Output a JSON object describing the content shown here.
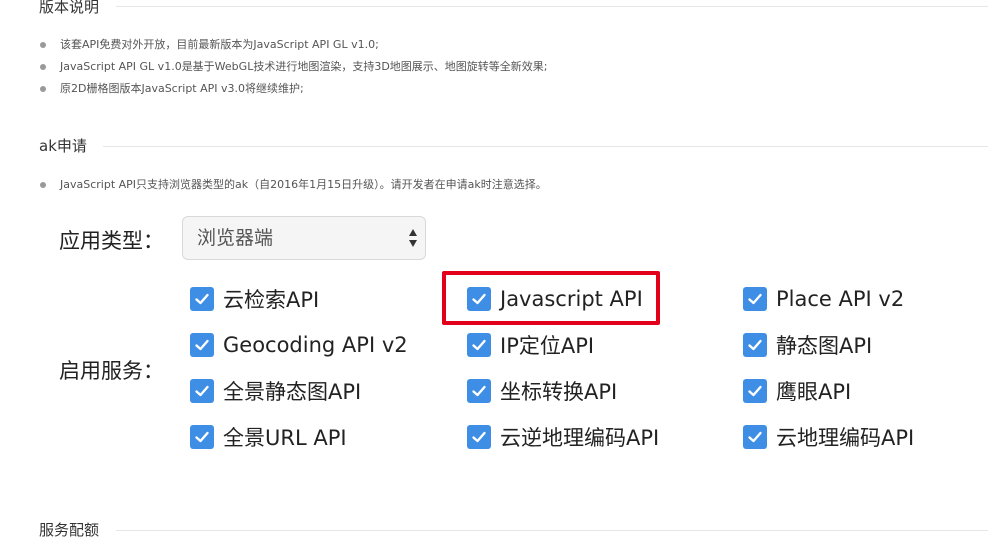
{
  "sections": {
    "version": {
      "title": "版本说明",
      "bullets": [
        "该套API免费对外开放，目前最新版本为JavaScript API GL v1.0;",
        "JavaScript API GL v1.0是基于WebGL技术进行地图渲染，支持3D地图展示、地图旋转等全新效果;",
        "原2D栅格图版本JavaScript API v3.0将继续维护;"
      ]
    },
    "ak": {
      "title": "ak申请",
      "bullets": [
        "JavaScript API只支持浏览器类型的ak（自2016年1月15日升级）。请开发者在申请ak时注意选择。"
      ]
    },
    "quota": {
      "title": "服务配额"
    }
  },
  "form": {
    "app_type_label": "应用类型：",
    "app_type_value": "浏览器端",
    "services_label": "启用服务：",
    "services": [
      {
        "label": "云检索API",
        "checked": true
      },
      {
        "label": "Javascript API",
        "checked": true,
        "highlighted": true
      },
      {
        "label": "Place API v2",
        "checked": true
      },
      {
        "label": "Geocoding API v2",
        "checked": true
      },
      {
        "label": "IP定位API",
        "checked": true
      },
      {
        "label": "静态图API",
        "checked": true
      },
      {
        "label": "全景静态图API",
        "checked": true
      },
      {
        "label": "坐标转换API",
        "checked": true
      },
      {
        "label": "鹰眼API",
        "checked": true
      },
      {
        "label": "全景URL API",
        "checked": true
      },
      {
        "label": "云逆地理编码API",
        "checked": true
      },
      {
        "label": "云地理编码API",
        "checked": true
      }
    ]
  },
  "colors": {
    "checkbox": "#3d8ee4",
    "highlight": "#e2001a"
  },
  "icons": {
    "checkbox": "check-icon",
    "select_arrows": "sort-arrows-icon",
    "bullet": "bullet-dot-icon"
  }
}
